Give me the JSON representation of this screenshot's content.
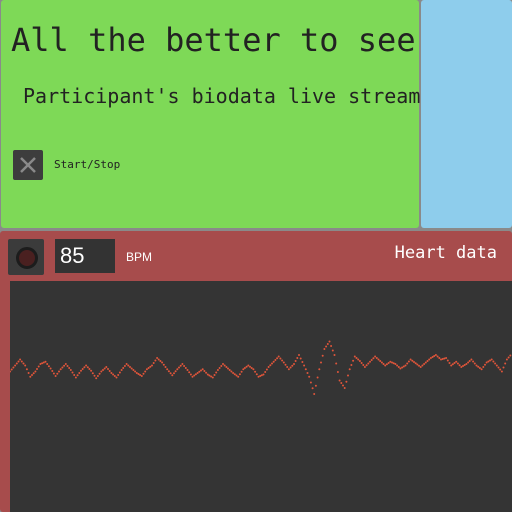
{
  "header": {
    "title": "All the better to see",
    "subtitle": "Participant's biodata live stream",
    "toggle_label": "Start/Stop"
  },
  "heart": {
    "title": "Heart data",
    "bpm_value": "85",
    "bpm_unit": "BPM"
  },
  "colors": {
    "top_panel": "#7ed957",
    "side_panel": "#8ecdec",
    "heart_panel": "#a74c4c",
    "plot_bg": "#343434",
    "trace": "#e0553a"
  },
  "icons": {
    "toggle": "close-x-icon",
    "status": "status-ring-icon"
  },
  "chart_data": {
    "type": "scatter",
    "title": "",
    "xlabel": "",
    "ylabel": "",
    "x_range": [
      0,
      100
    ],
    "y_range": [
      -1,
      1
    ],
    "grid": false,
    "series": [
      {
        "values": [
          0.02,
          0.1,
          0.18,
          0.1,
          -0.05,
          0.02,
          0.12,
          0.15,
          0.06,
          -0.04,
          0.05,
          0.12,
          0.04,
          -0.06,
          0.03,
          0.1,
          0.03,
          -0.07,
          0.02,
          0.08,
          0.0,
          -0.06,
          0.04,
          0.12,
          0.06,
          0.0,
          -0.04,
          0.05,
          0.1,
          0.2,
          0.14,
          0.05,
          -0.03,
          0.05,
          0.12,
          0.04,
          -0.05,
          0.0,
          0.05,
          -0.02,
          -0.06,
          0.04,
          0.12,
          0.06,
          0.0,
          -0.05,
          0.05,
          0.1,
          0.05,
          -0.05,
          -0.02,
          0.08,
          0.15,
          0.22,
          0.14,
          0.05,
          0.12,
          0.24,
          0.1,
          -0.05,
          -0.28,
          0.05,
          0.32,
          0.42,
          0.24,
          -0.1,
          -0.2,
          0.05,
          0.22,
          0.16,
          0.08,
          0.15,
          0.22,
          0.16,
          0.1,
          0.15,
          0.12,
          0.06,
          0.1,
          0.18,
          0.13,
          0.08,
          0.14,
          0.2,
          0.24,
          0.18,
          0.2,
          0.1,
          0.15,
          0.08,
          0.12,
          0.18,
          0.1,
          0.05,
          0.14,
          0.18,
          0.1,
          0.02,
          0.18,
          0.26
        ]
      }
    ]
  }
}
